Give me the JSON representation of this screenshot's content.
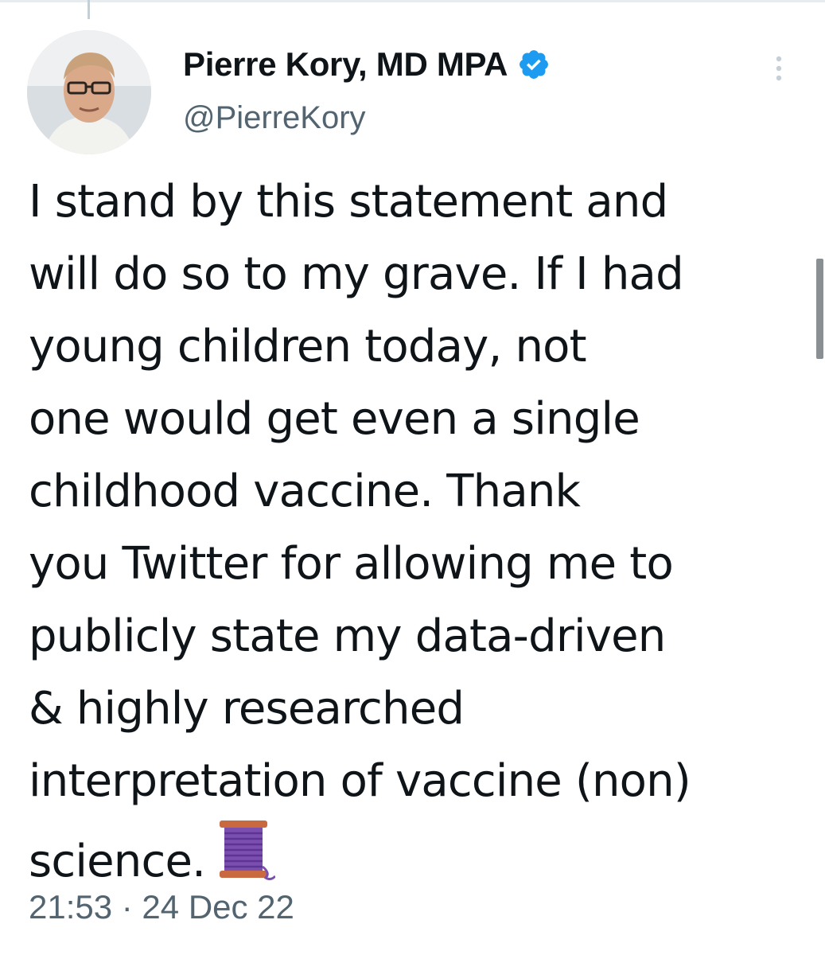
{
  "tweet": {
    "author": {
      "display_name": "Pierre Kory, MD MPA",
      "handle": "@PierreKory",
      "verified": true,
      "avatar": "profile-photo"
    },
    "text_lines": [
      "I stand by this statement and",
      "will do so to my grave. If I had",
      "young children today, not",
      "one would get even a single",
      "childhood vaccine. Thank",
      "you Twitter for allowing me to",
      "publicly state my data-driven",
      "& highly researched",
      "interpretation of vaccine (non)",
      "science."
    ],
    "trailing_emoji": "thread-spool-icon",
    "timestamp": "21:53 · 24 Dec 22"
  },
  "icons": {
    "verified": "verified-badge-icon",
    "more": "more-options-icon"
  },
  "colors": {
    "text": "#0f1419",
    "secondary": "#536471",
    "verified_blue": "#1d9bf0"
  }
}
